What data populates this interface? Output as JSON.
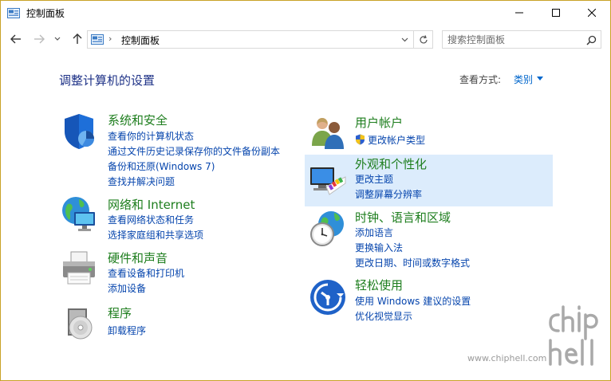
{
  "window": {
    "title": "控制面板",
    "accent_border": "#c9a227"
  },
  "nav": {
    "address_path": "控制面板",
    "search_placeholder": "搜索控制面板"
  },
  "main": {
    "page_title": "调整计算机的设置",
    "view_by_label": "查看方式:",
    "view_by_value": "类别"
  },
  "categories_left": [
    {
      "title": "系统和安全",
      "icon": "shield-pie-icon",
      "links": [
        "查看你的计算机状态",
        "通过文件历史记录保存你的文件备份副本",
        "备份和还原(Windows 7)",
        "查找并解决问题"
      ]
    },
    {
      "title": "网络和 Internet",
      "icon": "network-globe-icon",
      "links": [
        "查看网络状态和任务",
        "选择家庭组和共享选项"
      ]
    },
    {
      "title": "硬件和声音",
      "icon": "printer-icon",
      "links": [
        "查看设备和打印机",
        "添加设备"
      ]
    },
    {
      "title": "程序",
      "icon": "programs-disc-icon",
      "links": [
        "卸载程序"
      ]
    }
  ],
  "categories_right": [
    {
      "title": "用户帐户",
      "icon": "users-icon",
      "links": [
        "更改帐户类型"
      ]
    },
    {
      "title": "外观和个性化",
      "icon": "display-palette-icon",
      "links": [
        "更改主题",
        "调整屏幕分辨率"
      ]
    },
    {
      "title": "时钟、语言和区域",
      "icon": "clock-globe-icon",
      "links": [
        "添加语言",
        "更换输入法",
        "更改日期、时间或数字格式"
      ]
    },
    {
      "title": "轻松使用",
      "icon": "ease-of-access-icon",
      "links": [
        "使用 Windows 建议的设置",
        "优化视觉显示"
      ]
    }
  ],
  "watermark": {
    "logo_text": "chip hell",
    "url": "www.chiphell.com"
  },
  "colors": {
    "category_title": "#1e7e1e",
    "link": "#0645ad",
    "page_title": "#1e3287",
    "hover_highlight": "#dcecfc"
  }
}
